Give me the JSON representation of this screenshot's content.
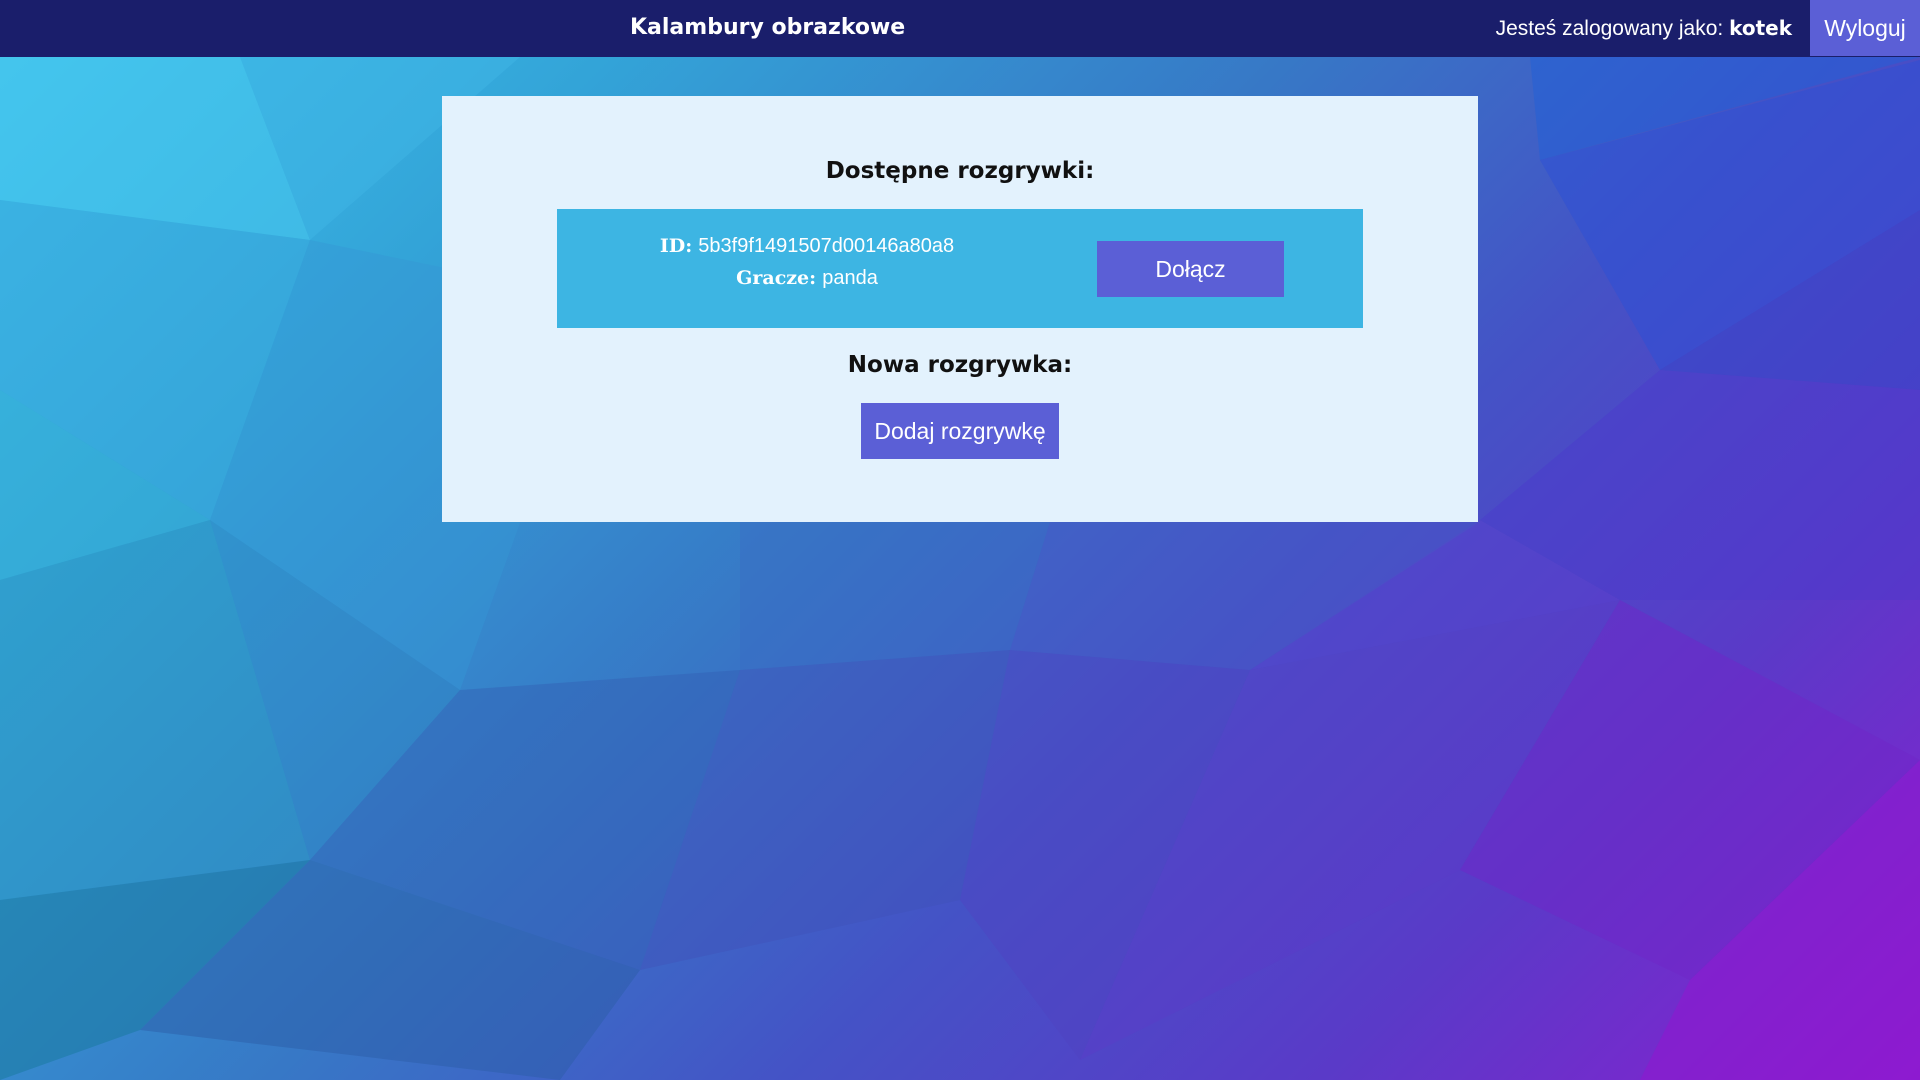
{
  "header": {
    "title": "Kalambury obrazkowe",
    "logged_in_prefix": "Jesteś zalogowany jako:",
    "username": "kotek",
    "logout_label": "Wyloguj"
  },
  "games": {
    "available_title": "Dostępne rozgrywki:",
    "list": [
      {
        "id_label": "ID:",
        "id": "5b3f9f1491507d00146a80a8",
        "players_label": "Gracze:",
        "players": "panda",
        "join_label": "Dołącz"
      }
    ]
  },
  "new_game": {
    "title": "Nowa rozgrywka:",
    "add_label": "Dodaj rozgrywkę"
  },
  "colors": {
    "header_bg": "#1a1e6b",
    "button_bg": "#5b5fd6",
    "panel_bg": "#e3f2fd",
    "card_bg": "#3db5e3"
  }
}
